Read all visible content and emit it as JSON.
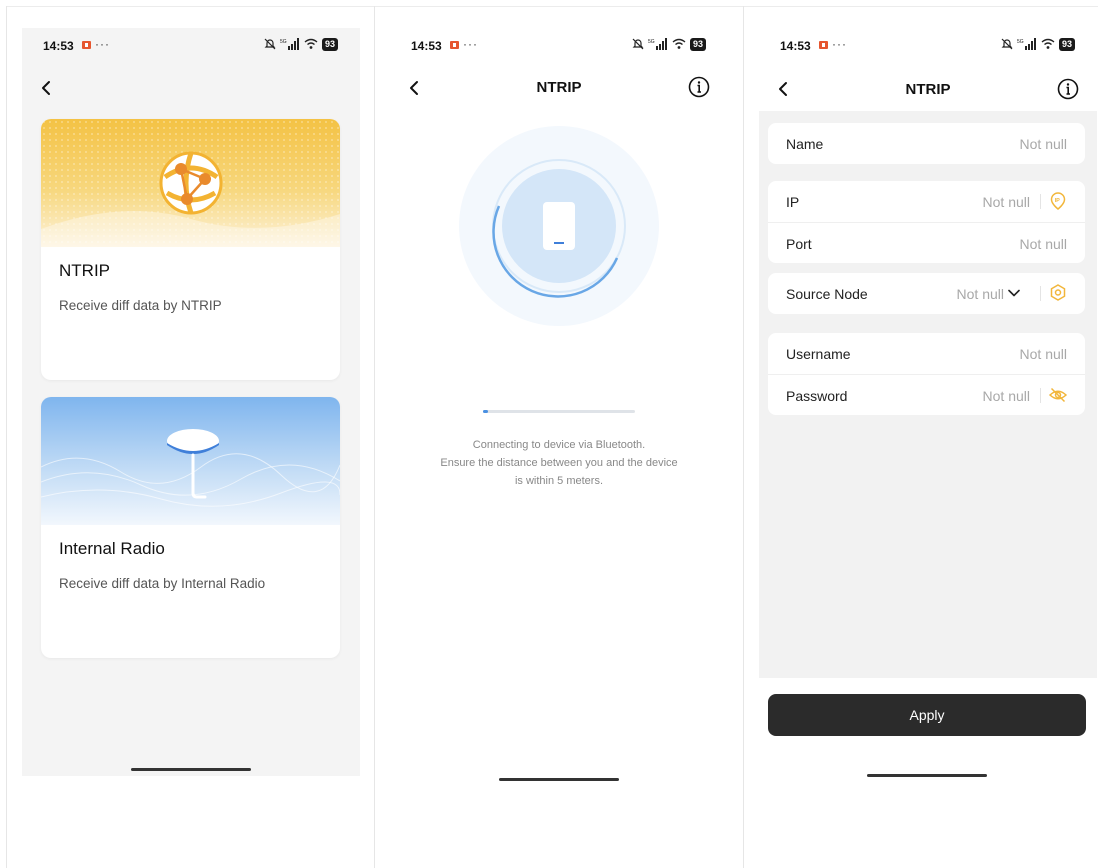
{
  "status_bar": {
    "time": "14:53",
    "dots": "···",
    "network": "5G",
    "battery": "93"
  },
  "screen1": {
    "cards": [
      {
        "title": "NTRIP",
        "description": "Receive diff data by NTRIP"
      },
      {
        "title": "Internal Radio",
        "description": "Receive diff data by Internal Radio"
      }
    ]
  },
  "screen2": {
    "title": "NTRIP",
    "progress": 0.03,
    "message_lines": [
      "Connecting to device via Bluetooth.",
      "Ensure the distance between you and the device",
      "is within 5 meters."
    ]
  },
  "screen3": {
    "title": "NTRIP",
    "fields": {
      "name": {
        "label": "Name",
        "placeholder": "Not null"
      },
      "ip": {
        "label": "IP",
        "placeholder": "Not null"
      },
      "port": {
        "label": "Port",
        "placeholder": "Not null"
      },
      "source_node": {
        "label": "Source Node",
        "placeholder": "Not null"
      },
      "username": {
        "label": "Username",
        "placeholder": "Not null"
      },
      "password": {
        "label": "Password",
        "placeholder": "Not null"
      }
    },
    "apply_label": "Apply"
  },
  "colors": {
    "accent": "#f2b63a",
    "button": "#2b2b2b",
    "bluetooth": "#4a90e2"
  }
}
